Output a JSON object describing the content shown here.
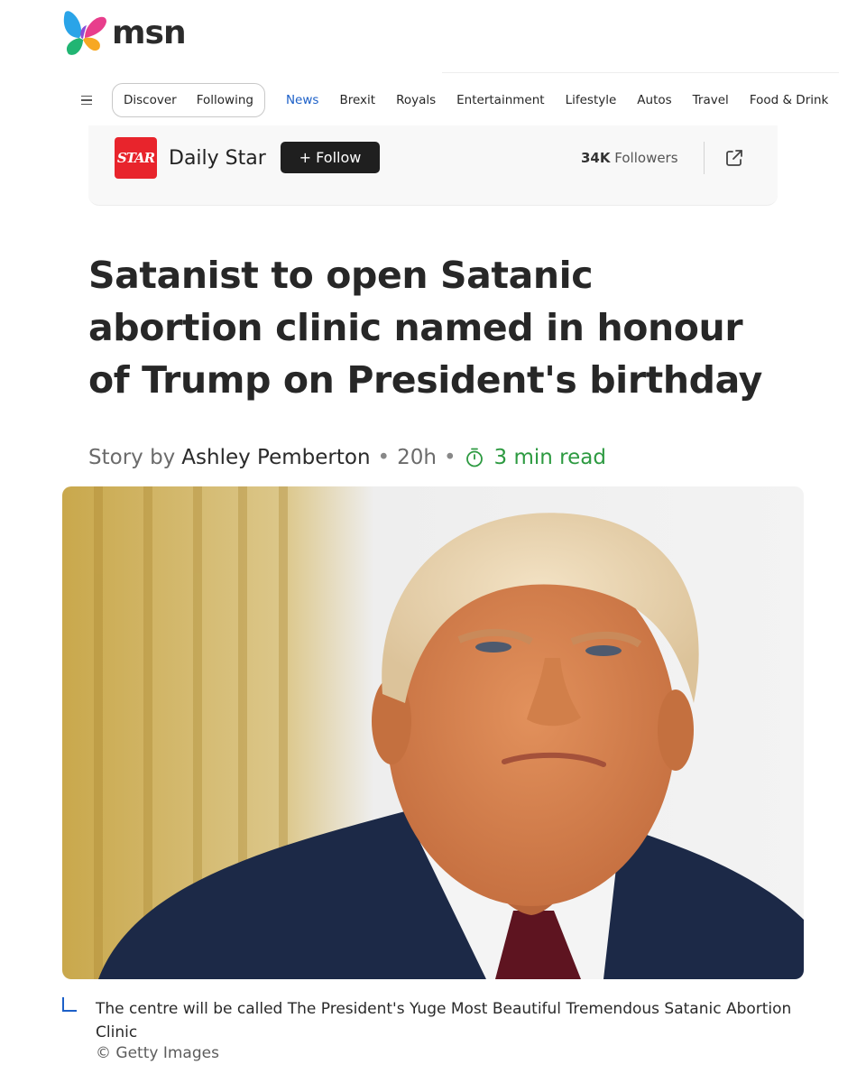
{
  "brand": {
    "name": "msn"
  },
  "nav": {
    "menu_icon": "hamburger-icon",
    "pill_items": [
      "Discover",
      "Following"
    ],
    "links": [
      "News",
      "Brexit",
      "Royals",
      "Entertainment",
      "Lifestyle",
      "Autos",
      "Travel",
      "Food & Drink"
    ],
    "active_link": "News",
    "accent_color": "#1c60c8"
  },
  "source": {
    "logo_text": "STAR",
    "logo_color": "#e8242c",
    "name": "Daily Star",
    "follow_label": "+ Follow",
    "followers_count": "34K",
    "followers_label": "Followers",
    "external_icon": "external-link-icon"
  },
  "article": {
    "headline": "Satanist to open Satanic abortion clinic named in honour of Trump on President's birthday",
    "byline_prefix": "Story by",
    "author": "Ashley Pemberton",
    "age": "20h",
    "read_time": "3 min read",
    "read_time_icon": "stopwatch-icon",
    "read_time_color": "#2d9a41",
    "image": {
      "caption": "The centre will be called The President's Yuge Most Beautiful Tremendous Satanic Abortion Clinic",
      "credit": "© Getty Images"
    }
  }
}
